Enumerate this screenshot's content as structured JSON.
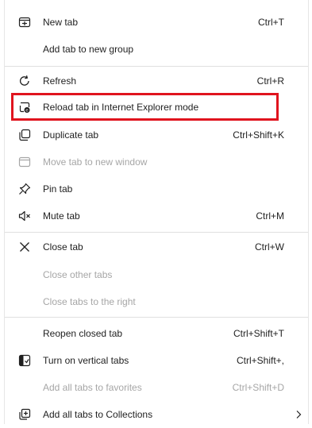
{
  "menu": {
    "items": [
      {
        "label": "New tab",
        "shortcut": "Ctrl+T",
        "icon": "new-tab-icon",
        "enabled": true
      },
      {
        "label": "Add tab to new group",
        "shortcut": "",
        "icon": "",
        "enabled": true
      },
      {
        "label": "Refresh",
        "shortcut": "Ctrl+R",
        "icon": "refresh-icon",
        "enabled": true
      },
      {
        "label": "Reload tab in Internet Explorer mode",
        "shortcut": "",
        "icon": "ie-mode-icon",
        "enabled": true
      },
      {
        "label": "Duplicate tab",
        "shortcut": "Ctrl+Shift+K",
        "icon": "duplicate-icon",
        "enabled": true
      },
      {
        "label": "Move tab to new window",
        "shortcut": "",
        "icon": "new-window-icon",
        "enabled": false
      },
      {
        "label": "Pin tab",
        "shortcut": "",
        "icon": "pin-icon",
        "enabled": true
      },
      {
        "label": "Mute tab",
        "shortcut": "Ctrl+M",
        "icon": "mute-icon",
        "enabled": true
      },
      {
        "label": "Close tab",
        "shortcut": "Ctrl+W",
        "icon": "close-icon",
        "enabled": true
      },
      {
        "label": "Close other tabs",
        "shortcut": "",
        "icon": "",
        "enabled": false
      },
      {
        "label": "Close tabs to the right",
        "shortcut": "",
        "icon": "",
        "enabled": false
      },
      {
        "label": "Reopen closed tab",
        "shortcut": "Ctrl+Shift+T",
        "icon": "",
        "enabled": true
      },
      {
        "label": "Turn on vertical tabs",
        "shortcut": "Ctrl+Shift+,",
        "icon": "vertical-tabs-icon",
        "enabled": true
      },
      {
        "label": "Add all tabs to favorites",
        "shortcut": "Ctrl+Shift+D",
        "icon": "",
        "enabled": false
      },
      {
        "label": "Add all tabs to Collections",
        "shortcut": "",
        "icon": "collections-icon",
        "enabled": true,
        "submenu": true
      }
    ]
  },
  "colors": {
    "highlight_border": "#e0141e",
    "text": "#1f1f1f",
    "disabled_text": "#a6a6a6",
    "separator": "#e0e0e0"
  }
}
